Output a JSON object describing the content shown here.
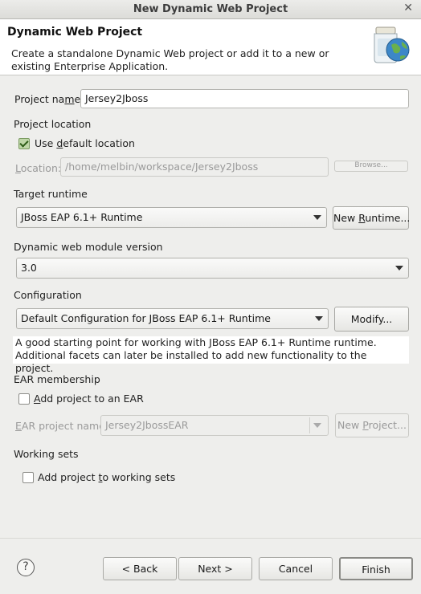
{
  "window": {
    "title": "New Dynamic Web Project",
    "close_glyph": "✕"
  },
  "header": {
    "title": "Dynamic Web Project",
    "description": "Create a standalone Dynamic Web project or add it to a new or existing Enterprise Application."
  },
  "project_name": {
    "label": "Project name:",
    "value": "Jersey2Jboss"
  },
  "project_location": {
    "section": "Project location",
    "use_default_label": "Use default location",
    "use_default_checked": true,
    "location_label": "Location:",
    "location_value": "/home/melbin/workspace/Jersey2Jboss",
    "browse_label": "Browse..."
  },
  "target_runtime": {
    "section": "Target runtime",
    "selected": "JBoss EAP 6.1+ Runtime",
    "new_runtime_label": "New Runtime..."
  },
  "module_version": {
    "section": "Dynamic web module version",
    "selected": "3.0"
  },
  "configuration": {
    "section": "Configuration",
    "selected": "Default Configuration for JBoss EAP 6.1+ Runtime",
    "modify_label": "Modify...",
    "description": "A good starting point for working with JBoss EAP 6.1+ Runtime runtime. Additional facets can later be installed to add new functionality to the project."
  },
  "ear": {
    "section": "EAR membership",
    "add_label": "Add project to an EAR",
    "add_checked": false,
    "project_name_label": "EAR project name:",
    "project_name_value": "Jersey2JbossEAR",
    "new_project_label": "New Project..."
  },
  "working_sets": {
    "section": "Working sets",
    "add_label": "Add project to working sets",
    "add_checked": false
  },
  "footer": {
    "help_glyph": "?",
    "back_label": "< Back",
    "next_label": "Next >",
    "cancel_label": "Cancel",
    "finish_label": "Finish"
  }
}
